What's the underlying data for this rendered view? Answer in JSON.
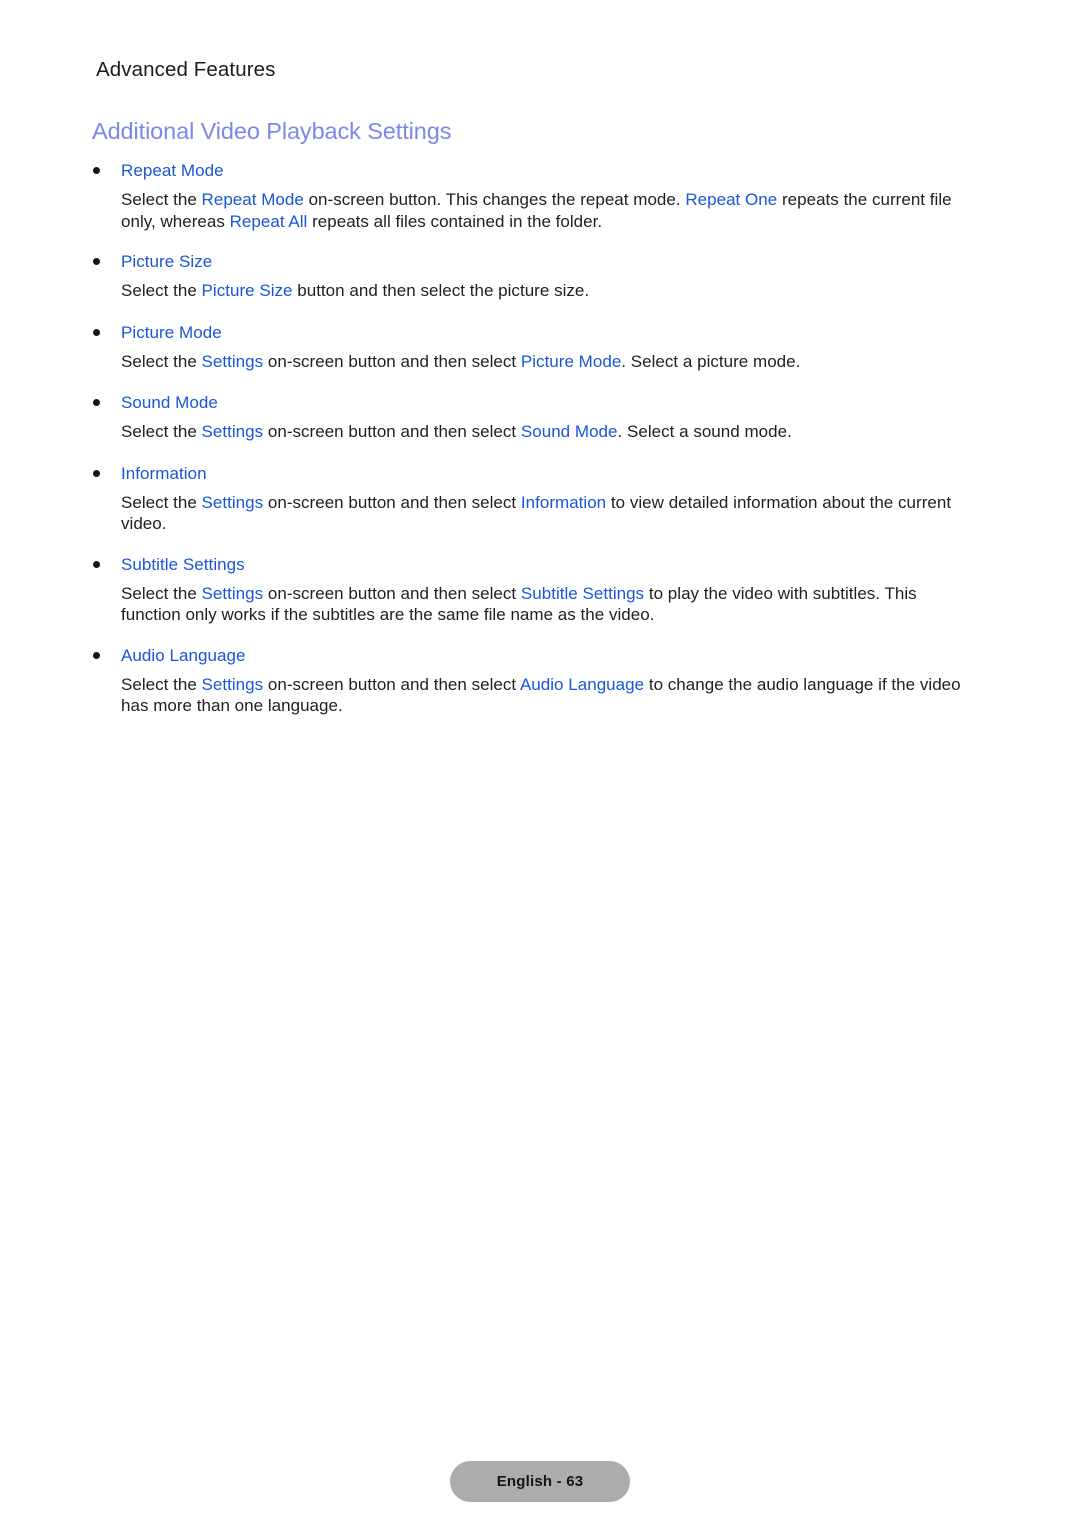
{
  "document": {
    "chapter_title": "Advanced Features",
    "section_title": "Additional Video Playback Settings",
    "colors": {
      "page_background": "#ffffff",
      "section_title": "#7b88e8",
      "link_blue": "#1a56d6",
      "body_text": "#1f1f1f",
      "bullet": "#161616",
      "footer_pill_background": "#acacac"
    }
  },
  "entries": [
    {
      "heading": "Repeat Mode",
      "body_parts": [
        {
          "text": "Select the ",
          "link": false
        },
        {
          "text": "Repeat Mode",
          "link": true
        },
        {
          "text": " on-screen button. This changes the repeat mode. ",
          "link": false
        },
        {
          "text": "Repeat One",
          "link": true
        },
        {
          "text": " repeats the current file only, whereas ",
          "link": false
        },
        {
          "text": "Repeat All",
          "link": true
        },
        {
          "text": " repeats all files contained in the folder.",
          "link": false
        }
      ],
      "body_plain": "Select the Repeat Mode on-screen button. This changes the repeat mode. Repeat One repeats the current file only, whereas Repeat All repeats all files contained in the folder."
    },
    {
      "heading": "Picture Size",
      "body_parts": [
        {
          "text": "Select the ",
          "link": false
        },
        {
          "text": "Picture Size",
          "link": true
        },
        {
          "text": " button and then select the picture size.",
          "link": false
        }
      ],
      "body_plain": "Select the Picture Size button and then select the picture size."
    },
    {
      "heading": "Picture Mode",
      "body_parts": [
        {
          "text": "Select the ",
          "link": false
        },
        {
          "text": "Settings",
          "link": true
        },
        {
          "text": " on-screen button and then select ",
          "link": false
        },
        {
          "text": "Picture Mode",
          "link": true
        },
        {
          "text": ". Select a picture mode.",
          "link": false
        }
      ],
      "body_plain": "Select the Settings on-screen button and then select Picture Mode. Select a picture mode."
    },
    {
      "heading": "Sound Mode",
      "body_parts": [
        {
          "text": "Select the ",
          "link": false
        },
        {
          "text": "Settings",
          "link": true
        },
        {
          "text": " on-screen button and then select ",
          "link": false
        },
        {
          "text": "Sound Mode",
          "link": true
        },
        {
          "text": ". Select a sound mode.",
          "link": false
        }
      ],
      "body_plain": "Select the Settings on-screen button and then select Sound Mode. Select a sound mode."
    },
    {
      "heading": "Information",
      "body_parts": [
        {
          "text": "Select the ",
          "link": false
        },
        {
          "text": "Settings",
          "link": true
        },
        {
          "text": " on-screen button and then select ",
          "link": false
        },
        {
          "text": "Information",
          "link": true
        },
        {
          "text": " to view detailed information about the current video.",
          "link": false
        }
      ],
      "body_plain": "Select the Settings on-screen button and then select Information to view detailed information about the current video."
    },
    {
      "heading": "Subtitle Settings",
      "body_parts": [
        {
          "text": "Select the ",
          "link": false
        },
        {
          "text": "Settings",
          "link": true
        },
        {
          "text": " on-screen button and then select ",
          "link": false
        },
        {
          "text": "Subtitle Settings",
          "link": true
        },
        {
          "text": " to play the video with subtitles. This function only works if the subtitles are the same file name as the video.",
          "link": false
        }
      ],
      "body_plain": "Select the Settings on-screen button and then select Subtitle Settings to play the video with subtitles. This function only works if the subtitles are the same file name as the video."
    },
    {
      "heading": "Audio Language",
      "body_parts": [
        {
          "text": "Select the ",
          "link": false
        },
        {
          "text": "Settings",
          "link": true
        },
        {
          "text": " on-screen button and then select ",
          "link": false
        },
        {
          "text": "Audio Language",
          "link": true
        },
        {
          "text": " to change the audio language if the video has more than one language.",
          "link": false
        }
      ],
      "body_plain": "Select the Settings on-screen button and then select Audio Language to change the audio language if the video has more than one language."
    }
  ],
  "footer": {
    "page_label": "English - 63"
  }
}
